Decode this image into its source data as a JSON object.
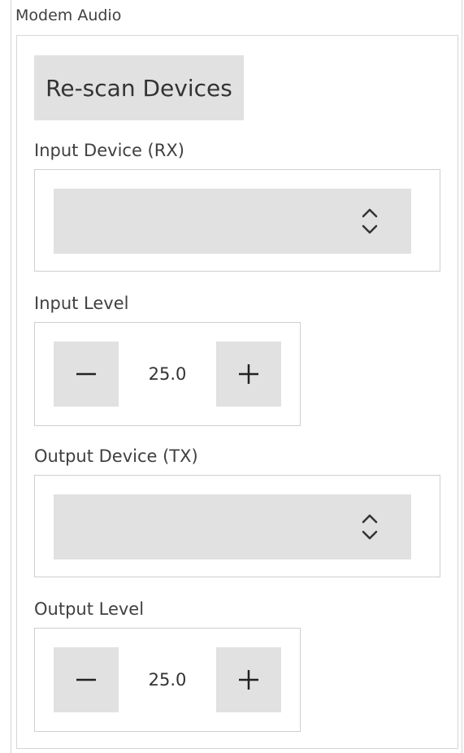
{
  "group": {
    "title": "Modem Audio"
  },
  "rescan": {
    "label": "Re-scan Devices"
  },
  "input_device": {
    "label": "Input Device (RX)",
    "value": "",
    "icon": "spinner-updown-icon"
  },
  "input_level": {
    "label": "Input Level",
    "value": "25.0",
    "minus_icon": "minus-icon",
    "plus_icon": "plus-icon"
  },
  "output_device": {
    "label": "Output Device (TX)",
    "value": "",
    "icon": "spinner-updown-icon"
  },
  "output_level": {
    "label": "Output Level",
    "value": "25.0",
    "minus_icon": "minus-icon",
    "plus_icon": "plus-icon"
  },
  "colors": {
    "control_bg": "#e1e1e1",
    "border": "#d6d6d6",
    "text": "#333333"
  }
}
